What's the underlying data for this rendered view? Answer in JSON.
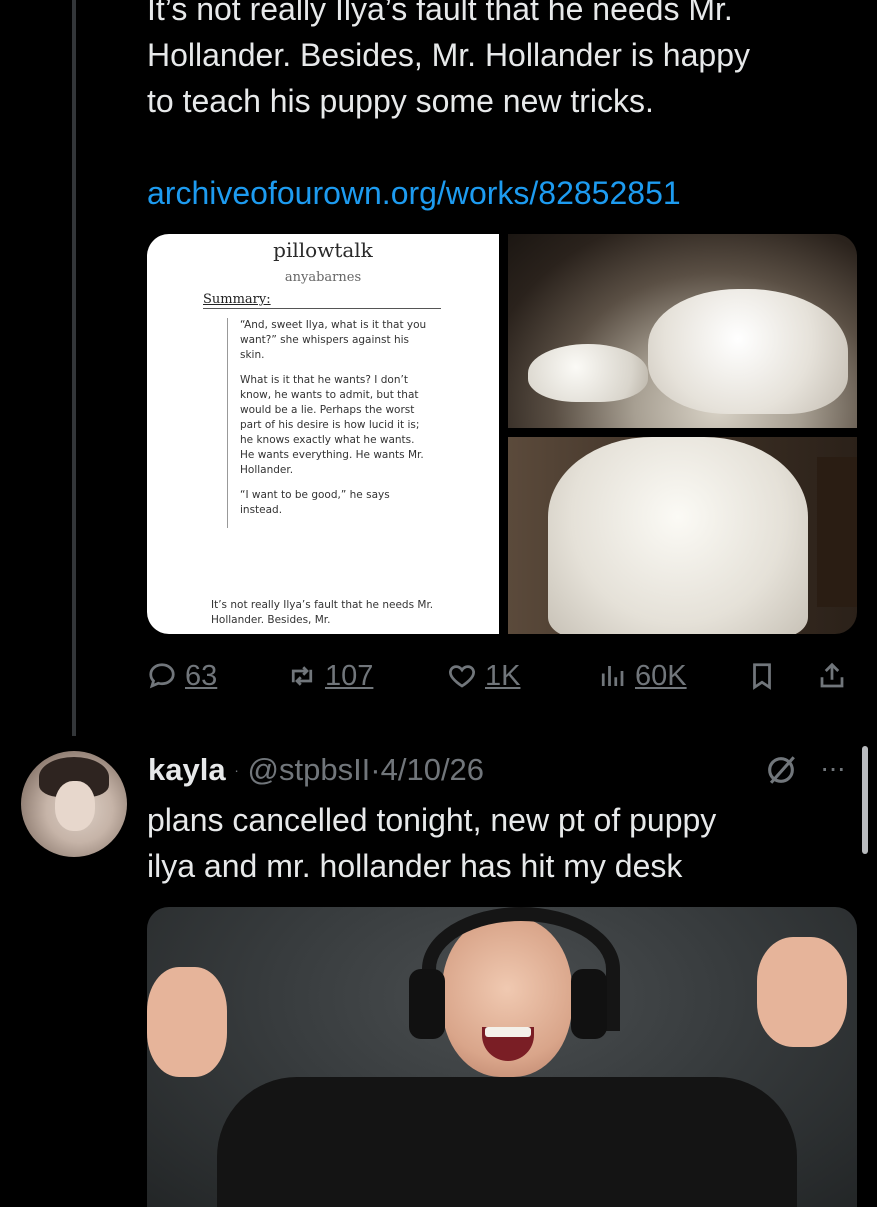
{
  "post1": {
    "text_lines": [
      "It’s not really Ilya’s fault that he needs Mr.",
      "Hollander. Besides, Mr. Hollander is happy",
      "to teach his puppy some new tricks."
    ],
    "link": "archiveofourown.org/works/82852851",
    "doc_image": {
      "title": "pillowtalk",
      "author": "anyabarnes",
      "summary_label": "Summary:",
      "quote_paragraphs": [
        "“And, sweet Ilya, what is it that you want?” she whispers against his skin.",
        "What is it that he wants? I don’t know, he wants to admit, but that would be a lie. Perhaps the worst part of his desire is how lucid it is; he knows exactly what he wants. He wants everything. He wants Mr. Hollander.",
        "“I want to be good,” he says instead."
      ],
      "tail_text": "It’s not really Ilya’s fault that he needs Mr. Hollander. Besides, Mr."
    },
    "actions": {
      "replies": "63",
      "reposts": "107",
      "likes": "1K",
      "views": "60K"
    }
  },
  "post2": {
    "name": "kayla",
    "handle_date": "@stpbsII·4/10/26",
    "text_lines": [
      "plans cancelled tonight, new pt of puppy",
      "ilya and mr. hollander has hit my desk"
    ],
    "more_label": "···"
  },
  "colors": {
    "background": "#000000",
    "text": "#e7e9ea",
    "muted": "#71767b",
    "link": "#1d9bf0"
  }
}
